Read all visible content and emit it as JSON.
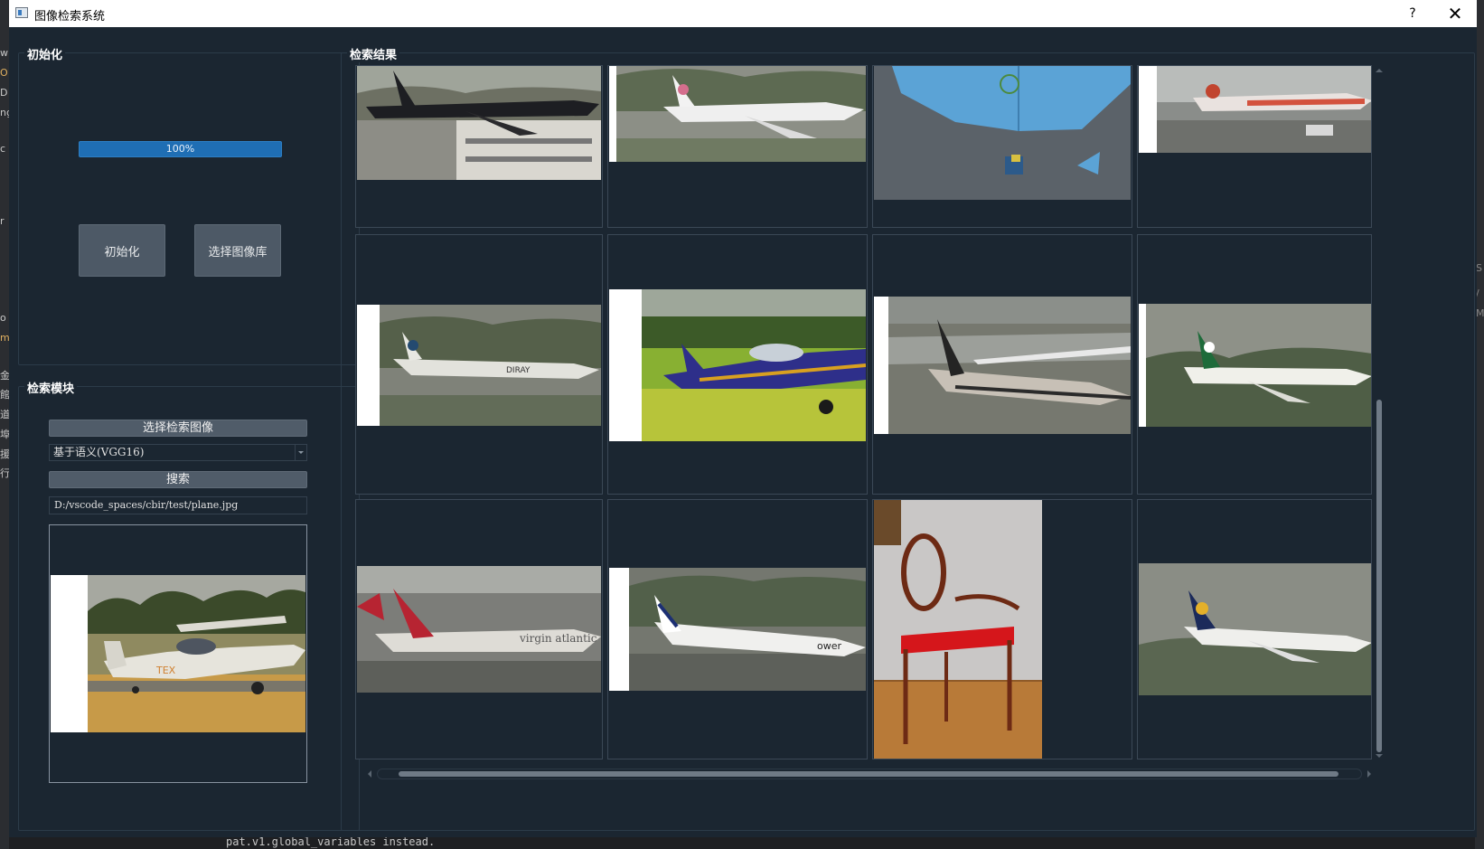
{
  "window": {
    "title": "图像检索系统",
    "help": "?",
    "close": "✕"
  },
  "init_group": {
    "title": "初始化",
    "progress_text": "100%",
    "progress_value": 1.0,
    "init_button": "初始化",
    "library_button": "选择图像库"
  },
  "search_group": {
    "title": "检索模块",
    "select_image_button": "选择检索图像",
    "method_selected": "基于语义(VGG16)",
    "search_button": "搜索",
    "query_path": "D:/vscode_spaces/cbir/test/plane.jpg"
  },
  "results_group": {
    "title": "检索结果",
    "items": [
      {
        "subject": "airliner"
      },
      {
        "subject": "airliner"
      },
      {
        "subject": "umbrella"
      },
      {
        "subject": "airliner"
      },
      {
        "subject": "airliner"
      },
      {
        "subject": "aerobatic plane"
      },
      {
        "subject": "airliner"
      },
      {
        "subject": "airliner"
      },
      {
        "subject": "airliner"
      },
      {
        "subject": "airliner"
      },
      {
        "subject": "chair"
      },
      {
        "subject": "airliner"
      }
    ]
  },
  "background": {
    "console_text": "pat.v1.global_variables instead.",
    "left_fragments": [
      "w",
      "O",
      "D",
      "ng",
      "c",
      "r",
      "o",
      "m",
      "金",
      "館",
      "道",
      "埠",
      "援",
      "行"
    ],
    "right_fragments": [
      "S",
      "/",
      "M"
    ]
  }
}
